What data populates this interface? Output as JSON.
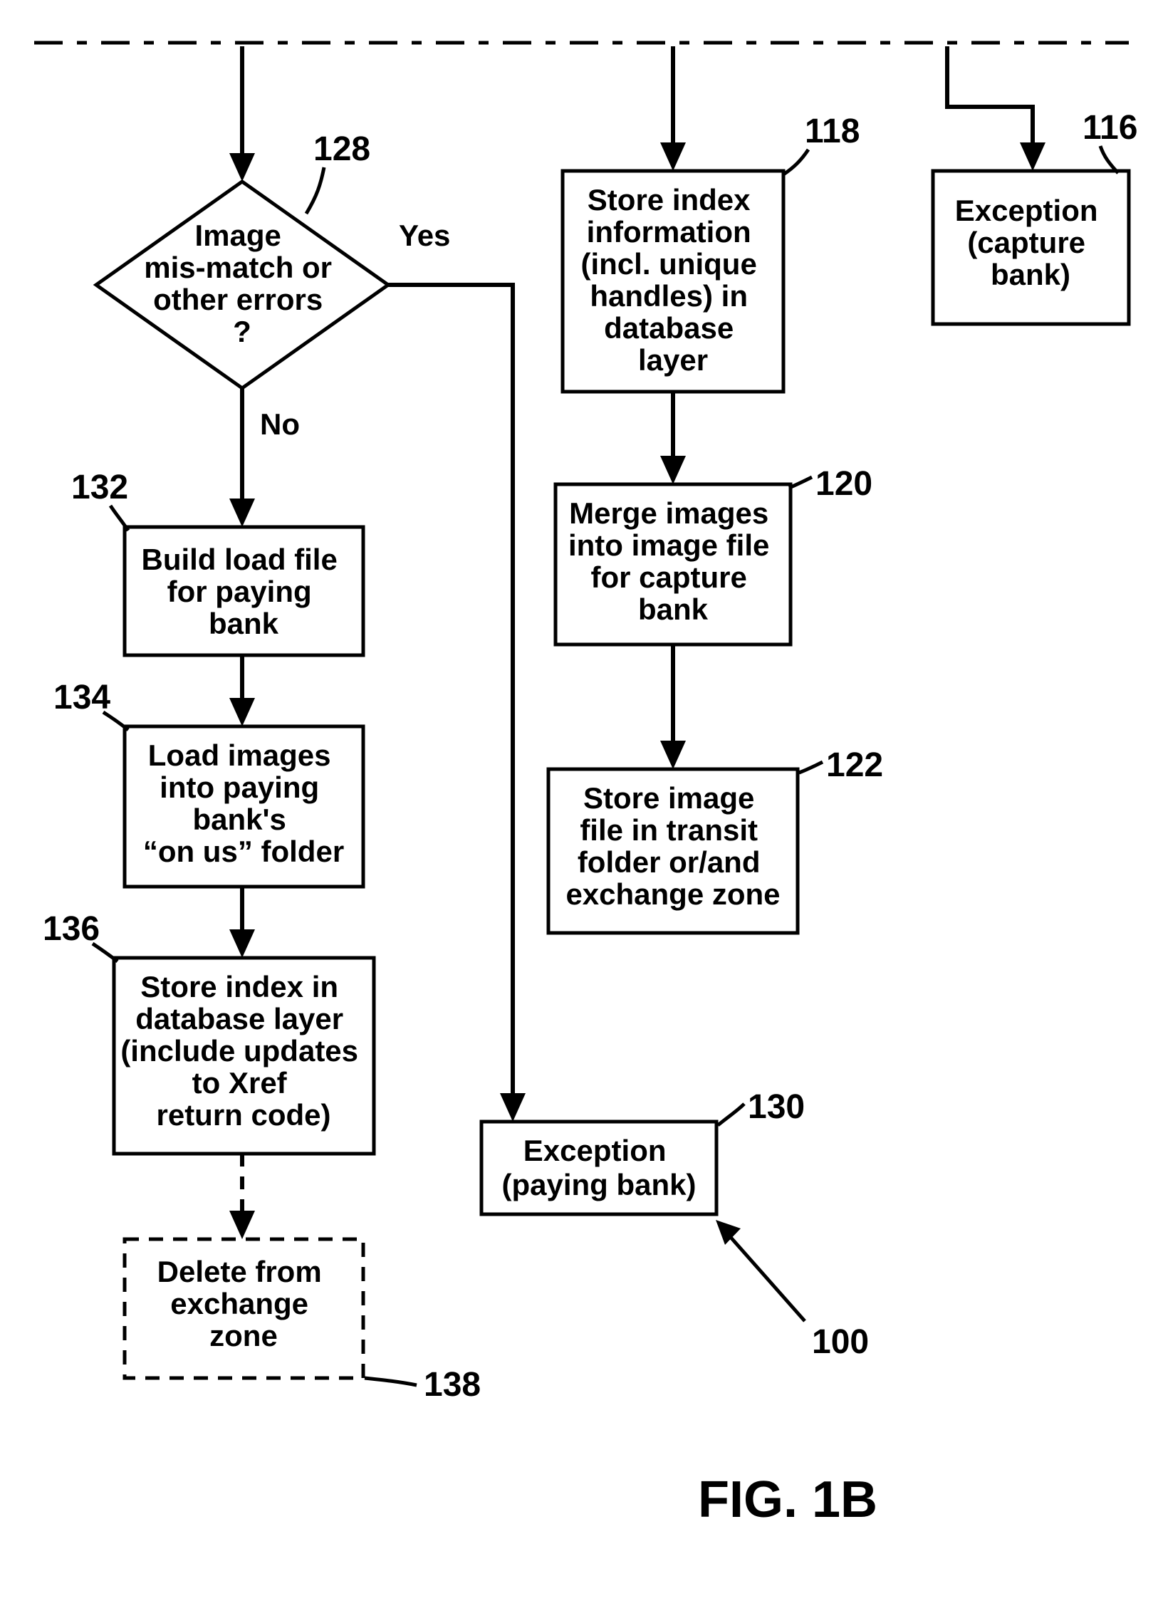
{
  "chart_data": {
    "type": "flowchart",
    "figure_label": "FIG. 1B",
    "overall_ref": "100",
    "nodes": [
      {
        "id": "128",
        "ref": "128",
        "shape": "decision",
        "text": [
          "Image",
          "mis-match or",
          "other errors",
          "?"
        ]
      },
      {
        "id": "132",
        "ref": "132",
        "shape": "process",
        "text": [
          "Build load file",
          "for paying",
          "bank"
        ]
      },
      {
        "id": "134",
        "ref": "134",
        "shape": "process",
        "text": [
          "Load images",
          "into paying",
          "bank's",
          "“on us” folder"
        ]
      },
      {
        "id": "136",
        "ref": "136",
        "shape": "process",
        "text": [
          "Store index in",
          "database layer",
          "(include updates",
          "to Xref",
          "return code)"
        ]
      },
      {
        "id": "138",
        "ref": "138",
        "shape": "process-dashed",
        "text": [
          "Delete from",
          "exchange",
          "zone"
        ]
      },
      {
        "id": "118",
        "ref": "118",
        "shape": "process",
        "text": [
          "Store index",
          "information",
          "(incl. unique",
          "handles) in",
          "database",
          "layer"
        ]
      },
      {
        "id": "120",
        "ref": "120",
        "shape": "process",
        "text": [
          "Merge images",
          "into image file",
          "for capture",
          "bank"
        ]
      },
      {
        "id": "122",
        "ref": "122",
        "shape": "process",
        "text": [
          "Store image",
          "file in transit",
          "folder or/and",
          "exchange zone"
        ]
      },
      {
        "id": "130",
        "ref": "130",
        "shape": "process",
        "text": [
          "Exception",
          "(paying bank)"
        ]
      },
      {
        "id": "116",
        "ref": "116",
        "shape": "process",
        "text": [
          "Exception",
          "(capture",
          "bank)"
        ]
      }
    ],
    "edges": [
      {
        "from": "top",
        "to": "128"
      },
      {
        "from": "top",
        "to": "118"
      },
      {
        "from": "top",
        "to": "116"
      },
      {
        "from": "128",
        "to": "132",
        "label": "No"
      },
      {
        "from": "128",
        "to": "130",
        "label": "Yes"
      },
      {
        "from": "132",
        "to": "134"
      },
      {
        "from": "134",
        "to": "136"
      },
      {
        "from": "136",
        "to": "138",
        "style": "dashed"
      },
      {
        "from": "118",
        "to": "120"
      },
      {
        "from": "120",
        "to": "122"
      }
    ],
    "branch_labels": {
      "yes": "Yes",
      "no": "No"
    }
  }
}
